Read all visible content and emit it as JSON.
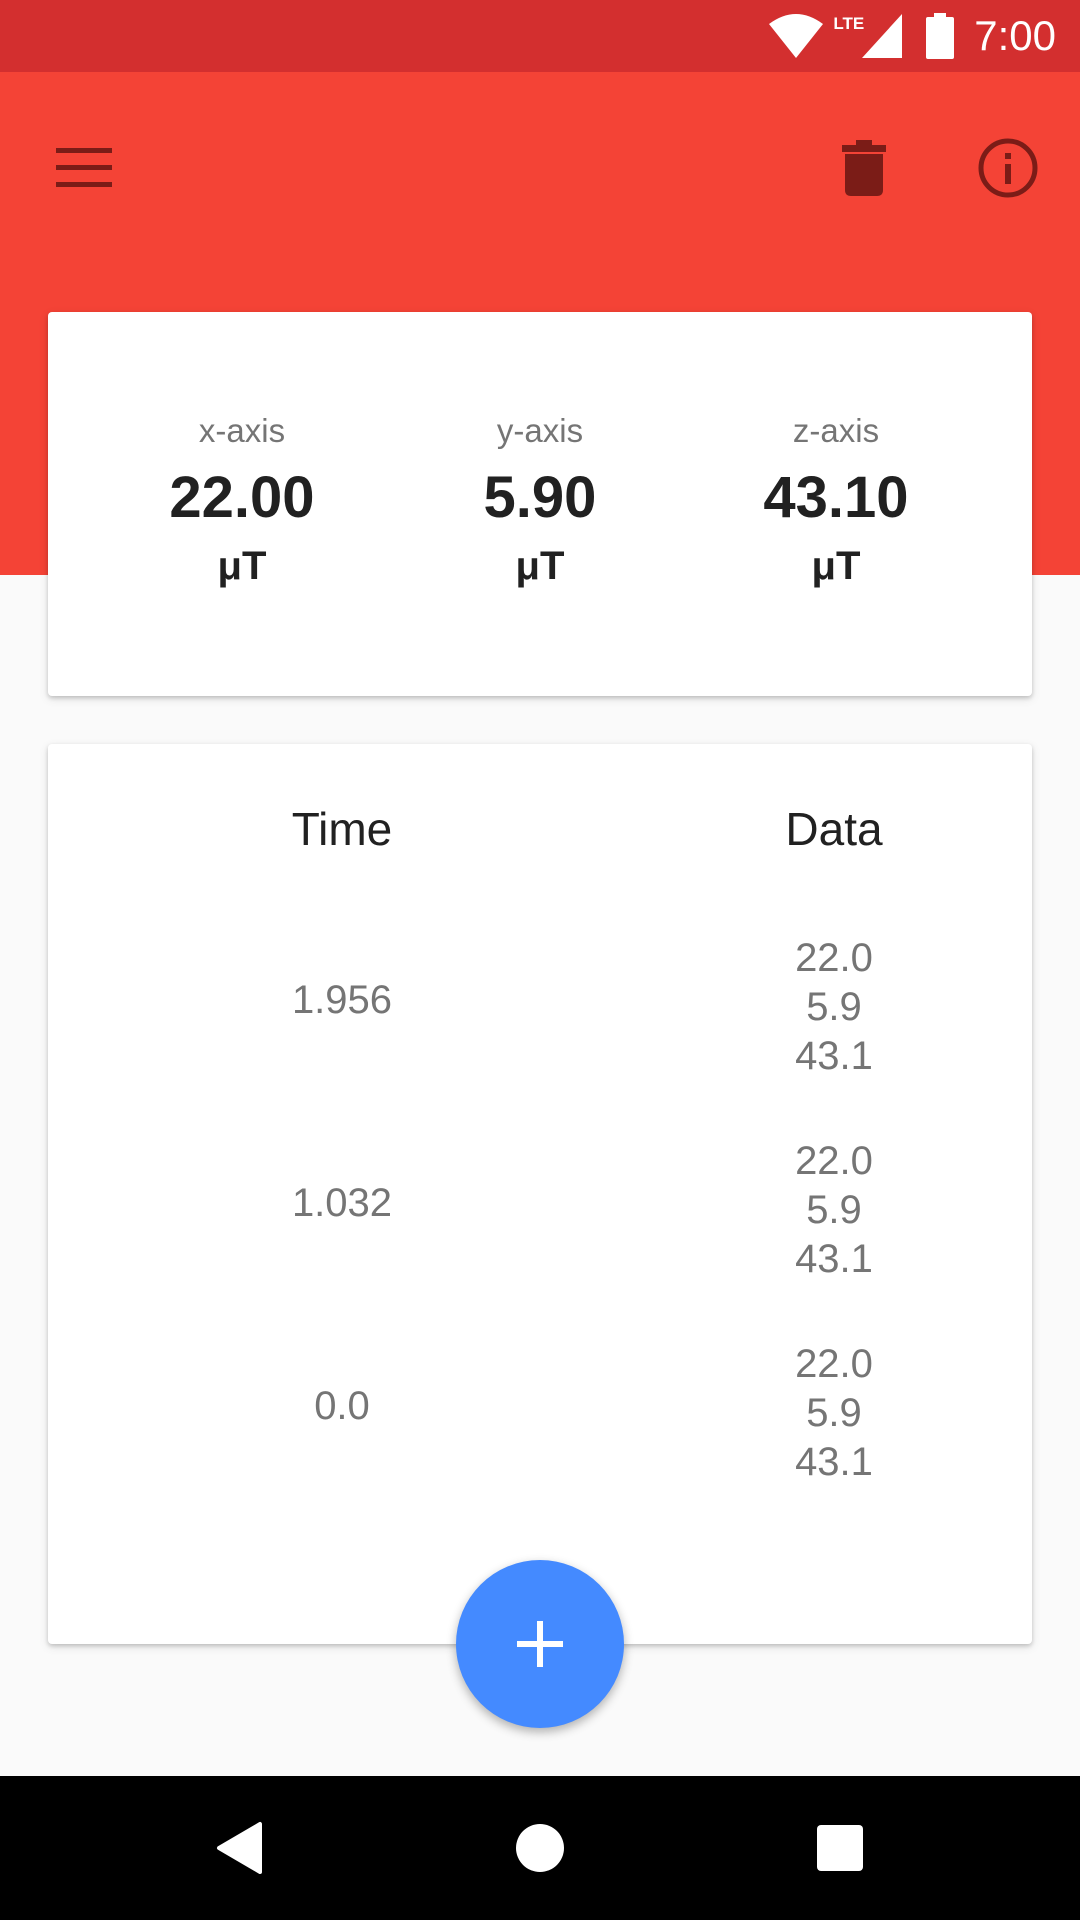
{
  "status_bar": {
    "time": "7:00",
    "network": "LTE"
  },
  "toolbar": {
    "menu_icon": "menu-icon",
    "delete_icon": "trash-icon",
    "info_icon": "info-icon"
  },
  "sensor": {
    "axes": [
      {
        "label": "x-axis",
        "value": "22.00",
        "unit": "μT"
      },
      {
        "label": "y-axis",
        "value": "5.90",
        "unit": "μT"
      },
      {
        "label": "z-axis",
        "value": "43.10",
        "unit": "μT"
      }
    ]
  },
  "table": {
    "headers": {
      "time": "Time",
      "data": "Data"
    },
    "rows": [
      {
        "time": "1.956",
        "x": "22.0",
        "y": "5.9",
        "z": "43.1"
      },
      {
        "time": "1.032",
        "x": "22.0",
        "y": "5.9",
        "z": "43.1"
      },
      {
        "time": "0.0",
        "x": "22.0",
        "y": "5.9",
        "z": "43.1"
      }
    ]
  },
  "fab": {
    "icon": "plus-icon"
  },
  "colors": {
    "status_bar": "#d32f2f",
    "toolbar": "#f44336",
    "toolbar_icons": "#7b1c17",
    "fab": "#448aff"
  }
}
